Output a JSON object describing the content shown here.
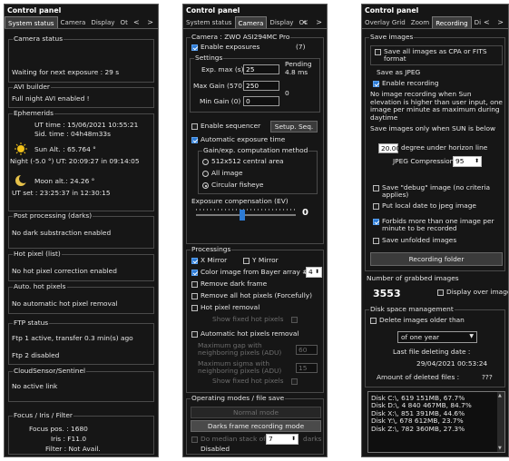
{
  "p1": {
    "title": "Control panel",
    "tabs": [
      "System status",
      "Camera",
      "Display",
      "Ot"
    ],
    "camera_status": {
      "title": "Camera status",
      "text": "Waiting for next exposure : 29 s"
    },
    "avi": {
      "title": "AVI builder",
      "text": "Full night AVI enabled !"
    },
    "ephem": {
      "title": "Ephemerids",
      "ut_time": "UT time : 15/06/2021 10:55:21",
      "sid_time": "Sid. time : 04h48m33s",
      "sun_alt": "Sun Alt. : 65.764 °",
      "night": "Night (-5.0 °) UT: 20:09:27 in 09:14:05",
      "moon_alt": "Moon alt.: 24.26 °",
      "ut_set": "UT set : 23:25:37 in 12:30:15"
    },
    "post": {
      "title": "Post processing (darks)",
      "text": "No dark substraction enabled"
    },
    "hotlist": {
      "title": "Hot pixel (list)",
      "text": "No hot pixel correction enabled"
    },
    "autohot": {
      "title": "Auto. hot pixels",
      "text": "No automatic hot pixel removal"
    },
    "ftp": {
      "title": "FTP status",
      "line1": "Ftp 1 active, transfer 0.3 min(s) ago",
      "line2": "Ftp 2 disabled"
    },
    "cloud": {
      "title": "CloudSensor/Sentinel",
      "text": "No active link"
    },
    "focus": {
      "title": "Focus / Iris / Filter",
      "pos": "Focus pos. : 1680",
      "iris": "Iris : F11.0",
      "filter": "Filter : Not Avail."
    }
  },
  "p2": {
    "title": "Control panel",
    "tabs": [
      "System status",
      "Camera",
      "Display",
      "Ot"
    ],
    "camera": {
      "title": "Camera : ZWO ASI294MC Pro",
      "enable_exposures": "Enable exposures",
      "count": "(7)",
      "settings_title": "Settings",
      "exp_max_label": "Exp. max (s)",
      "exp_max_value": "25",
      "pending_label": "Pending",
      "pending_value": "4.8 ms",
      "max_gain_label": "Max Gain (570)",
      "max_gain_value": "250",
      "min_gain_label": "Min Gain (0)",
      "min_gain_value": "0",
      "zero": "0",
      "enable_sequencer": "Enable sequencer",
      "setup_seq": "Setup. Seq.",
      "auto_exposure": "Automatic exposure time",
      "gain_method_title": "Gain/exp. computation method",
      "radio1": "512x512 central area",
      "radio2": "All image",
      "radio3": "Circular fisheye",
      "comp_title": "Exposure compensation (EV)",
      "comp_value": "0",
      "comp_position": 0.46
    },
    "processings": {
      "title": "Processings",
      "x_mirror": "X Mirror",
      "y_mirror": "Y Mirror",
      "bayer": "Color image from Bayer array #",
      "bayer_value": "4",
      "remove_dark": "Remove dark frame",
      "remove_hot": "Remove all hot pixels (Forcefully)",
      "hot_removal": "Hot pixel removal",
      "show_fixed": "Show fixed hot pixels",
      "auto_hot": "Automatic hot pixels removal",
      "max_gap": "Maximum gap with neighboring pixels (ADU)",
      "max_gap_value": "60",
      "max_sigma": "Maximum sigma with neighboring pixels (ADU)",
      "max_sigma_value": "15",
      "show_fixed2": "Show fixed hot pixels"
    },
    "opmodes": {
      "title": "Operating modes / file save",
      "normal": "Normal mode",
      "darks": "Darks frame recording mode",
      "median_label": "Do median stack of",
      "median_value": "7",
      "darks_suffix": "darks",
      "disabled": "Disabled"
    }
  },
  "p3": {
    "title": "Control panel",
    "tabs": [
      "Overlay Grid",
      "Zoom",
      "Recording",
      "Di"
    ],
    "save": {
      "title": "Save images",
      "cpa": "Save all images as CPA or FITS format",
      "jpeg": "Save as JPEG",
      "enable": "Enable recording",
      "note": "No image recording when Sun elevation is higher than user input, one image per minute as maximum during daytime",
      "sun_below": "Save images only when SUN is below",
      "degree_value": "20.00",
      "degree_label": "degree under horizon line",
      "jpeg_comp_label": "JPEG Compression",
      "jpeg_comp_value": "95",
      "debug": "Save \"debug\" image (no criteria applies)",
      "local_date": "Put local date to jpeg image",
      "forbid": "Forbids more than one image per minute to be recorded",
      "unfolded": "Save unfolded images",
      "rec_folder": "Recording folder"
    },
    "grabbed": {
      "title": "Number of grabbed images",
      "count": "3553",
      "display_over": "Display over image"
    },
    "disk": {
      "title": "Disk space management",
      "delete": "Delete images older than",
      "select": "of one year",
      "last_label": "Last file deleting date :",
      "last_value": "29/04/2021 00:53:24",
      "amount_label": "Amount of deleted files :",
      "amount_value": "???",
      "drives": [
        "Disk C:\\, 619 151MB, 67.7%",
        "Disk D:\\, 4 840 467MB, 84.7%",
        "Disk X:\\, 851 391MB, 44.6%",
        "Disk Y:\\, 678 612MB, 23.7%",
        "Disk Z:\\, 782 360MB, 27.3%"
      ]
    }
  },
  "colors": {
    "background": "#161616",
    "accent": "#2d7bd5",
    "border": "#5c5c5c",
    "sun": "#f2c21a"
  }
}
